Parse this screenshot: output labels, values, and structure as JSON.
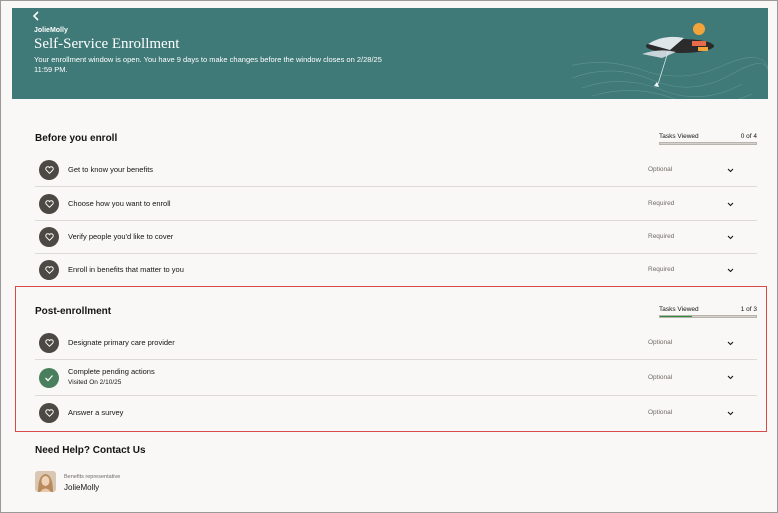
{
  "header": {
    "back_icon": "chevron-left-icon",
    "company": "JolieMolly",
    "title": "Self-Service Enrollment",
    "description": "Your enrollment window is open. You have 9 days to make changes before the window closes on 2/28/25 11:59 PM."
  },
  "before_enroll": {
    "title": "Before you enroll",
    "tasks_label": "Tasks Viewed",
    "tasks_count": "0 of 4",
    "progress_fraction": 0,
    "items": [
      {
        "label": "Get to know your benefits",
        "status": "Optional",
        "icon": "heart-icon"
      },
      {
        "label": "Choose how you want to enroll",
        "status": "Required",
        "icon": "heart-icon"
      },
      {
        "label": "Verify people you'd like to cover",
        "status": "Required",
        "icon": "heart-icon"
      },
      {
        "label": "Enroll in benefits that matter to you",
        "status": "Required",
        "icon": "heart-icon"
      }
    ]
  },
  "post_enrollment": {
    "title": "Post-enrollment",
    "tasks_label": "Tasks Viewed",
    "tasks_count": "1 of 3",
    "progress_fraction": 0.33,
    "items": [
      {
        "label": "Designate primary care provider",
        "status": "Optional",
        "icon": "heart-icon"
      },
      {
        "label": "Complete pending actions",
        "sublabel": "Visited On 2/10/25",
        "status": "Optional",
        "icon": "check-icon"
      },
      {
        "label": "Answer a survey",
        "status": "Optional",
        "icon": "heart-icon"
      }
    ]
  },
  "help": {
    "title": "Need Help? Contact Us",
    "role": "Benefits representative",
    "name": "JolieMolly"
  },
  "colors": {
    "banner": "#3f7a78",
    "accent_green": "#2e8b3e",
    "highlight_red": "#d94a4a"
  }
}
